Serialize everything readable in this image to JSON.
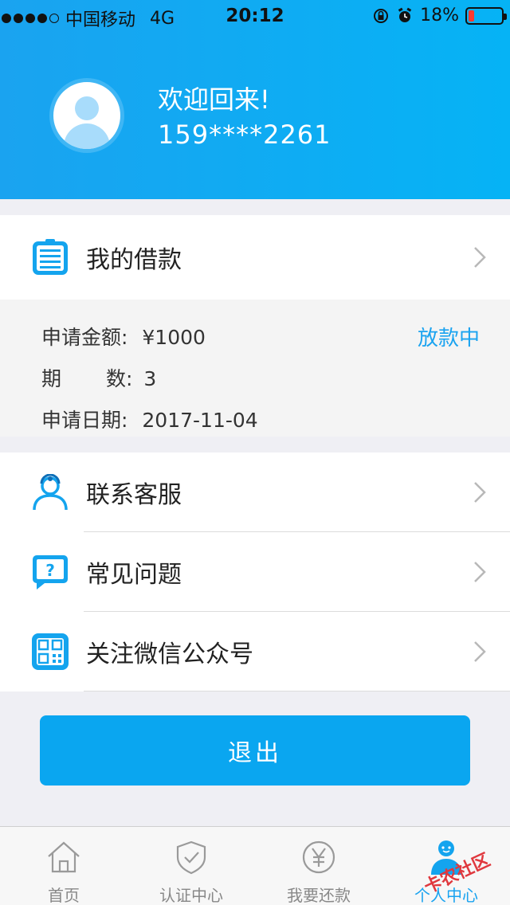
{
  "status_bar": {
    "carrier": "中国移动",
    "network": "4G",
    "time": "20:12",
    "battery": "18%",
    "battery_level": 0.18
  },
  "profile": {
    "welcome": "欢迎回来!",
    "phone": "159****2261"
  },
  "my_loan": {
    "label": "我的借款",
    "amount_label": "申请金额:",
    "amount_value": "¥1000",
    "status": "放款中",
    "periods_label": "期 数:",
    "periods_value": "3",
    "date_label": "申请日期:",
    "date_value": "2017-11-04"
  },
  "menu": {
    "contact": "联系客服",
    "faq": "常见问题",
    "wechat": "关注微信公众号"
  },
  "logout_label": "退出",
  "tabs": [
    {
      "label": "首页",
      "icon": "home-icon"
    },
    {
      "label": "认证中心",
      "icon": "shield-icon"
    },
    {
      "label": "我要还款",
      "icon": "yen-icon"
    },
    {
      "label": "个人中心",
      "icon": "user-icon"
    }
  ],
  "watermark": "卡农社区",
  "colors": {
    "accent": "#1aa3f0",
    "battery_low": "#ff3b30"
  }
}
